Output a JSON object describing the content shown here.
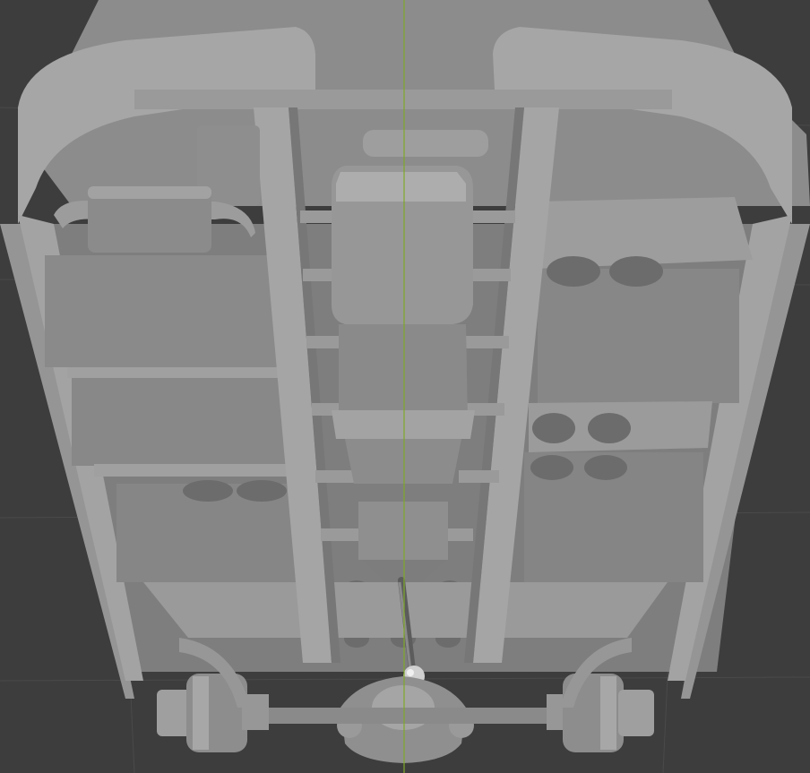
{
  "viewport": {
    "background": "#3d3d3d",
    "grid_line_color": "#4a4a4a",
    "vertical_axis_color": "#7fa82a",
    "model_base_color": "#8f8f8f",
    "model_light_color": "#a9a9a9",
    "model_shadow_color": "#6c6c6c",
    "model_edge_color": "#5a5a5a",
    "chrome_color": "#d8d8d8",
    "objects": {
      "chassis": "chassis-model",
      "engine": "engine-block",
      "exhaust": "exhaust-muffler",
      "drive_shaft": "drive-shaft",
      "left_wheel_hub": "left-wheel-hub",
      "right_wheel_hub": "right-wheel-hub",
      "differential": "rear-differential"
    }
  }
}
